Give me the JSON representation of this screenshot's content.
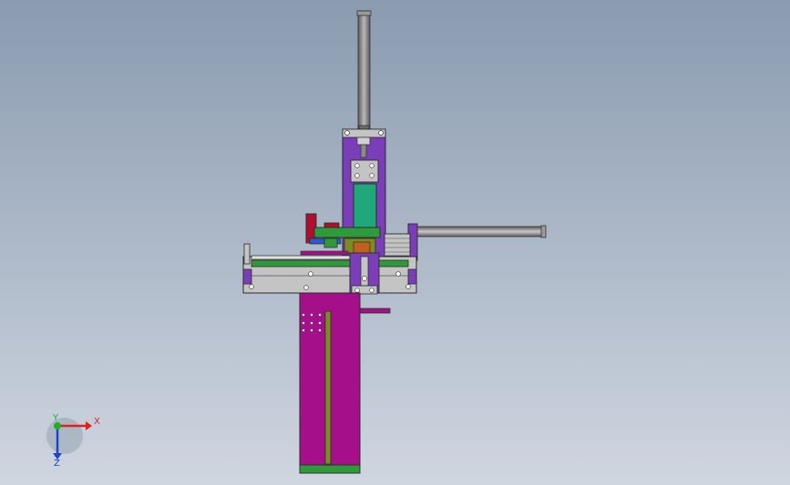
{
  "viewport": {
    "background_top": "#8a9bb0",
    "background_bottom": "#cfd6e0"
  },
  "colors": {
    "purple": "#7a3fb8",
    "magenta": "#a5108a",
    "green": "#2e9a3c",
    "teal": "#20a87a",
    "red": "#b01030",
    "olive": "#7c8c20",
    "steel": "#8a8a8a",
    "steel_light": "#c4c4c4",
    "outline": "#2a2a2a",
    "orange": "#c06020",
    "blue": "#3058c8"
  },
  "triad": {
    "x_label": "X",
    "y_label": "Y",
    "z_label": "Z",
    "x_color": "#e02020",
    "y_color": "#20b020",
    "z_color": "#2040d0"
  }
}
